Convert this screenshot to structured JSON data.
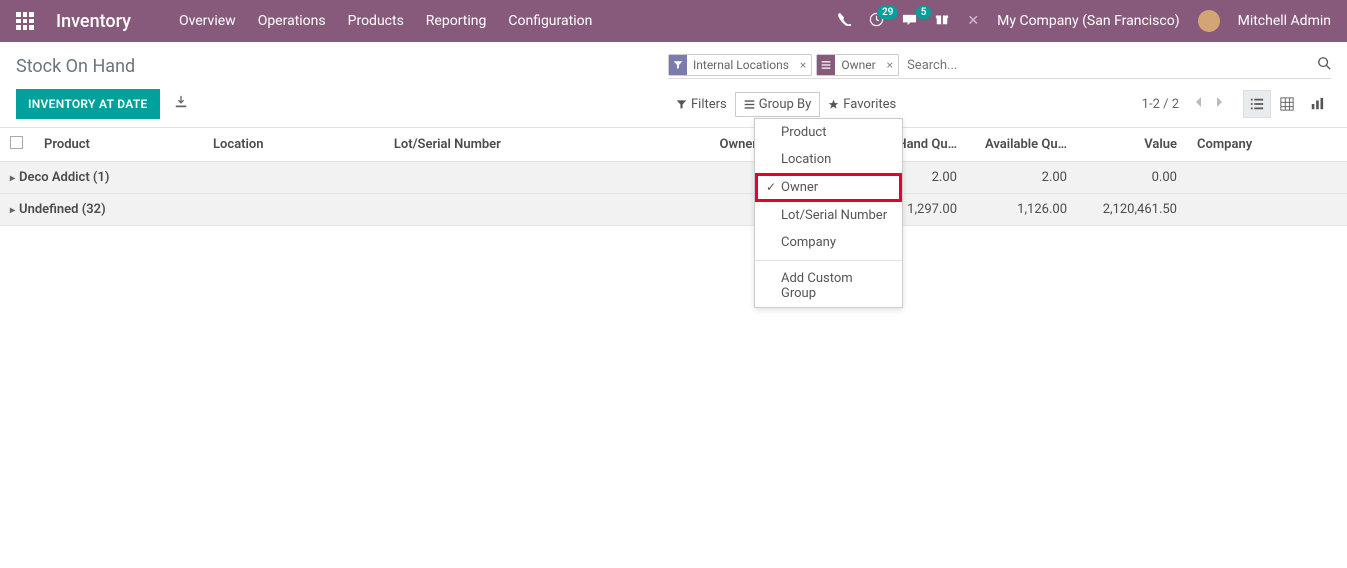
{
  "nav": {
    "app_title": "Inventory",
    "links": [
      "Overview",
      "Operations",
      "Products",
      "Reporting",
      "Configuration"
    ],
    "activity_count": "29",
    "message_count": "5",
    "company": "My Company (San Francisco)",
    "user": "Mitchell Admin"
  },
  "breadcrumb": "Stock On Hand",
  "buttons": {
    "inventory_at_date": "INVENTORY AT DATE"
  },
  "search": {
    "filter_facet": "Internal Locations",
    "group_facet": "Owner",
    "placeholder": "Search..."
  },
  "toolbar": {
    "filters": "Filters",
    "group_by": "Group By",
    "favorites": "Favorites",
    "pager": "1-2 / 2"
  },
  "groupby_menu": {
    "items": [
      "Product",
      "Location",
      "Owner",
      "Lot/Serial Number",
      "Company"
    ],
    "selected": "Owner",
    "custom": "Add Custom Group"
  },
  "columns": {
    "product": "Product",
    "location": "Location",
    "lot": "Lot/Serial Number",
    "owner": "Owner",
    "onhand": "On Hand Qu…",
    "available": "Available Qu…",
    "value": "Value",
    "company": "Company"
  },
  "rows": [
    {
      "label": "Deco Addict (1)",
      "onhand": "2.00",
      "available": "2.00",
      "value": "0.00"
    },
    {
      "label": "Undefined (32)",
      "onhand": "1,297.00",
      "available": "1,126.00",
      "value": "2,120,461.50"
    }
  ]
}
